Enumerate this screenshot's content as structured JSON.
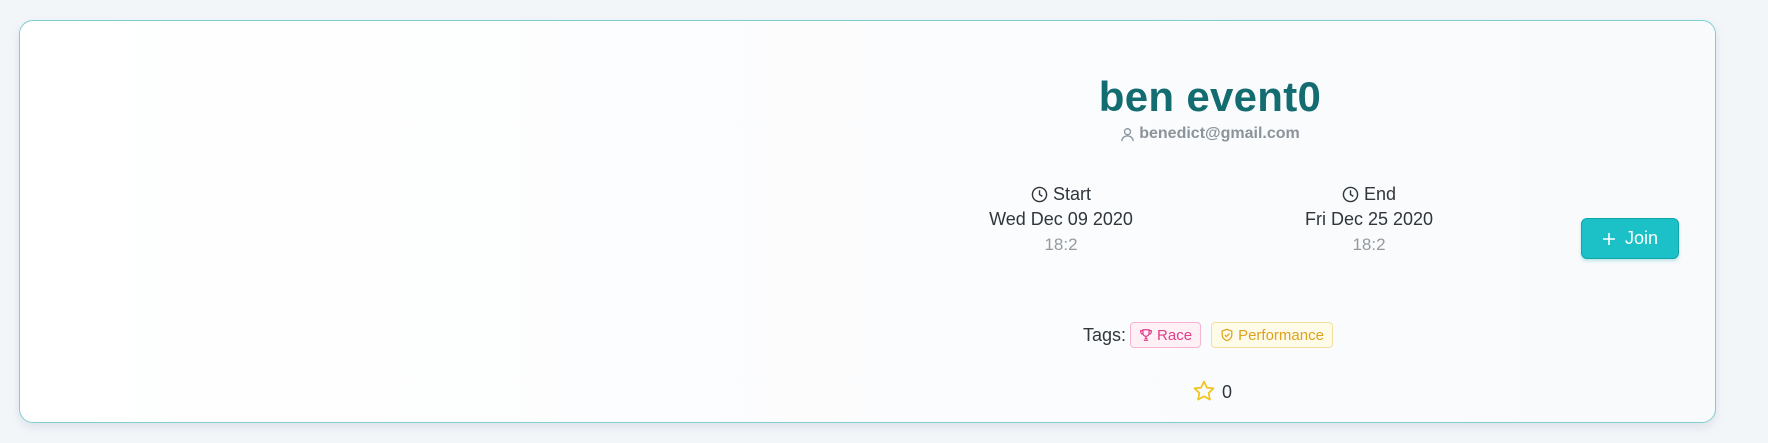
{
  "event": {
    "title": "ben event0",
    "organizer_email": "benedict@gmail.com",
    "start": {
      "label": "Start",
      "date": "Wed Dec 09 2020",
      "time": "18:2"
    },
    "end": {
      "label": "End",
      "date": "Fri Dec 25 2020",
      "time": "18:2"
    },
    "join_label": "Join",
    "tags_label": "Tags:",
    "tags": [
      {
        "label": "Race",
        "icon": "trophy-icon",
        "color": "#df3d8a"
      },
      {
        "label": "Performance",
        "icon": "shield-check-icon",
        "color": "#dca21f"
      }
    ],
    "rating": {
      "count": "0",
      "icon": "star-outline-icon",
      "color": "#f2c318"
    }
  },
  "colors": {
    "accent": "#1bc1c6",
    "title": "#136c70",
    "card_border": "#7fcfd1"
  }
}
